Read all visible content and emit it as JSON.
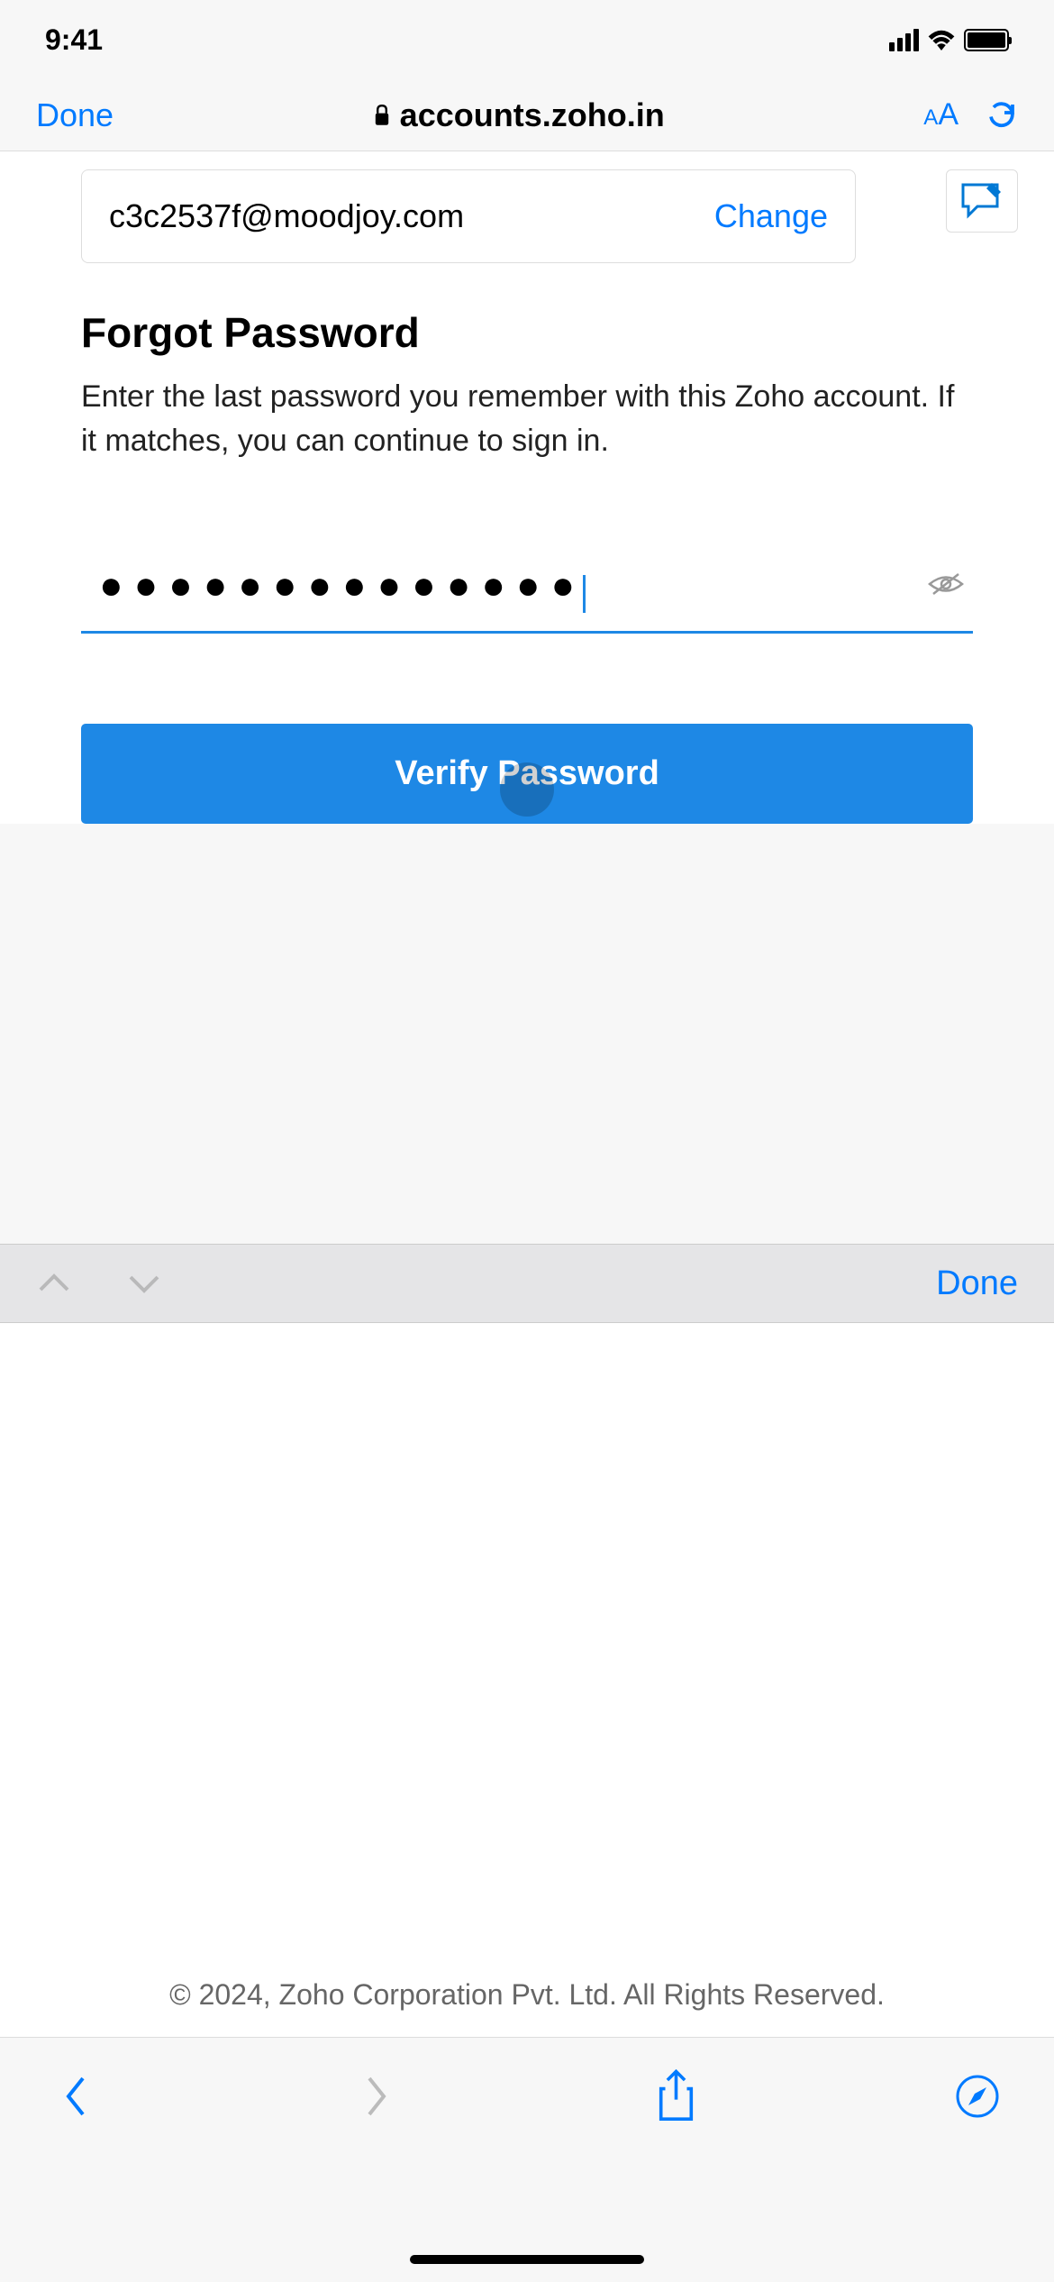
{
  "status": {
    "time": "9:41"
  },
  "browser": {
    "done_label": "Done",
    "url": "accounts.zoho.in",
    "reader_label": "AA"
  },
  "account": {
    "email": "c3c2537f@moodjoy.com",
    "change_label": "Change"
  },
  "page": {
    "title": "Forgot Password",
    "description": "Enter the last password you remember with this Zoho account. If it matches, you can continue to sign in."
  },
  "password": {
    "masked_value": "●●●●●●●●●●●●●●"
  },
  "buttons": {
    "verify_label": "Verify Password"
  },
  "keyboard": {
    "done_label": "Done"
  },
  "footer": {
    "copyright": "© 2024, Zoho Corporation Pvt. Ltd. All Rights Reserved."
  }
}
